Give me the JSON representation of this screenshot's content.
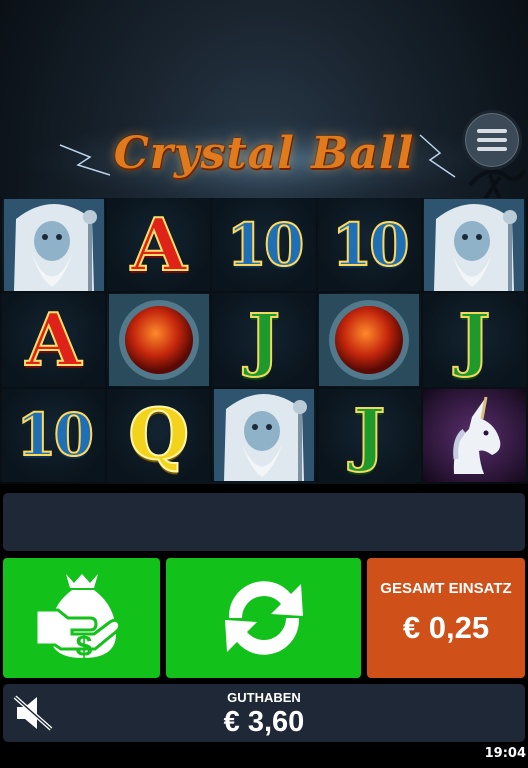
{
  "game": {
    "title": "Crystal Ball"
  },
  "menu": {
    "icon": "hamburger-menu-icon"
  },
  "reels": [
    [
      "wizard",
      "A",
      "10",
      "10",
      "wizard"
    ],
    [
      "A",
      "sun-orb",
      "J",
      "sun-orb",
      "J"
    ],
    [
      "10",
      "Q",
      "wizard",
      "J",
      "unicorn"
    ]
  ],
  "symbols": {
    "A": "A",
    "10": "10",
    "J": "J",
    "Q": "Q"
  },
  "controls": {
    "cashout_icon": "money-bag-icon",
    "spin_icon": "spin-arrows-icon",
    "bet_label": "GESAMT EINSATZ",
    "bet_value": "€ 0,25"
  },
  "balance": {
    "label": "GUTHABEN",
    "value": "€ 3,60",
    "sound_icon": "sound-muted-icon"
  },
  "status": {
    "time": "19:04"
  },
  "colors": {
    "green_button": "#12c21b",
    "bet_button": "#d0501a",
    "panel": "#1f2836",
    "logo": "#e07a1c"
  }
}
